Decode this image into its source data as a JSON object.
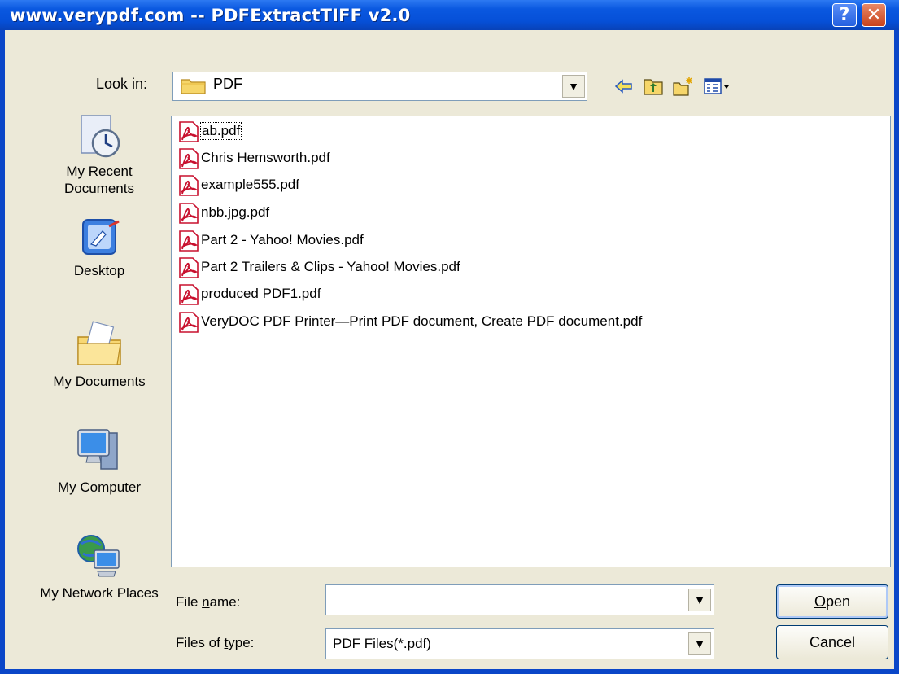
{
  "window": {
    "title": "www.verypdf.com -- PDFExtractTIFF v2.0",
    "help_label": "?",
    "close_label": "✕"
  },
  "lookin": {
    "label_pre": "Look ",
    "label_ul": "i",
    "label_post": "n:",
    "value": "PDF"
  },
  "places": [
    {
      "label": "My Recent Documents",
      "icon": "recent-documents-icon"
    },
    {
      "label": "Desktop",
      "icon": "desktop-icon"
    },
    {
      "label": "My Documents",
      "icon": "my-documents-icon"
    },
    {
      "label": "My Computer",
      "icon": "my-computer-icon"
    },
    {
      "label": "My Network Places",
      "icon": "network-places-icon"
    }
  ],
  "files": [
    "ab.pdf",
    "Chris Hemsworth.pdf",
    "example555.pdf",
    "nbb.jpg.pdf",
    "Part 2 - Yahoo! Movies.pdf",
    "Part 2 Trailers & Clips - Yahoo! Movies.pdf",
    "produced PDF1.pdf",
    "VeryDOC PDF Printer—Print PDF document, Create PDF document.pdf"
  ],
  "filename": {
    "label_pre": "File ",
    "label_ul": "n",
    "label_post": "ame:",
    "value": ""
  },
  "filetype": {
    "label_pre": "Files of ",
    "label_ul": "t",
    "label_post": "ype:",
    "value": "PDF Files(*.pdf)"
  },
  "buttons": {
    "open_ul": "O",
    "open_rest": "pen",
    "cancel": "Cancel"
  },
  "colors": {
    "titlebar": "#0a58e0",
    "dialog_bg": "#ece9d8",
    "pdf_icon": "#c8102e"
  }
}
